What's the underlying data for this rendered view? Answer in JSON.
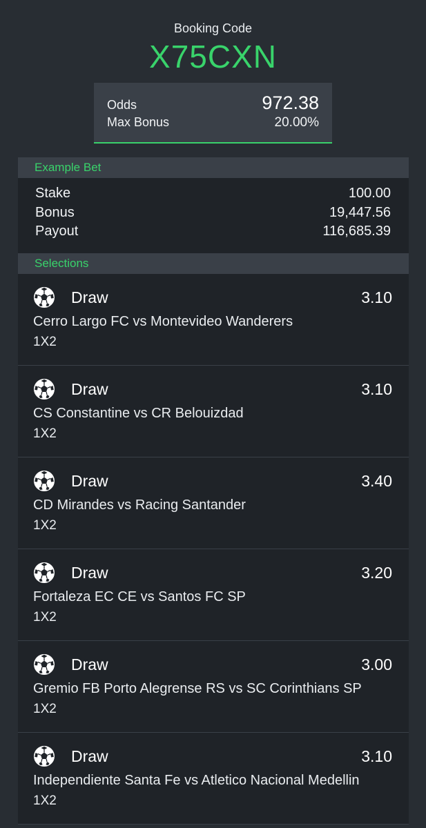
{
  "booking": {
    "label": "Booking Code",
    "code": "X75CXN"
  },
  "summary": {
    "odds_label": "Odds",
    "odds_value": "972.38",
    "bonus_label": "Max Bonus",
    "bonus_value": "20.00%"
  },
  "example_bet": {
    "title": "Example Bet",
    "rows": [
      {
        "label": "Stake",
        "value": "100.00"
      },
      {
        "label": "Bonus",
        "value": "19,447.56"
      },
      {
        "label": "Payout",
        "value": "116,685.39"
      }
    ]
  },
  "selections": {
    "title": "Selections",
    "items": [
      {
        "icon": "soccer-ball-icon",
        "pick": "Draw",
        "odds": "3.10",
        "match": "Cerro Largo FC vs Montevideo Wanderers",
        "market": "1X2"
      },
      {
        "icon": "soccer-ball-icon",
        "pick": "Draw",
        "odds": "3.10",
        "match": "CS Constantine vs CR Belouizdad",
        "market": "1X2"
      },
      {
        "icon": "soccer-ball-icon",
        "pick": "Draw",
        "odds": "3.40",
        "match": "CD Mirandes vs Racing Santander",
        "market": "1X2"
      },
      {
        "icon": "soccer-ball-icon",
        "pick": "Draw",
        "odds": "3.20",
        "match": "Fortaleza EC CE vs Santos FC SP",
        "market": "1X2"
      },
      {
        "icon": "soccer-ball-icon",
        "pick": "Draw",
        "odds": "3.00",
        "match": "Gremio FB Porto Alegrense RS vs SC Corinthians SP",
        "market": "1X2"
      },
      {
        "icon": "soccer-ball-icon",
        "pick": "Draw",
        "odds": "3.10",
        "match": "Independiente Santa Fe vs Atletico Nacional Medellin",
        "market": "1X2"
      }
    ]
  },
  "colors": {
    "accent": "#39d36b",
    "background": "#282d33",
    "panel": "#1f2328",
    "header_bar": "#3a4048"
  }
}
